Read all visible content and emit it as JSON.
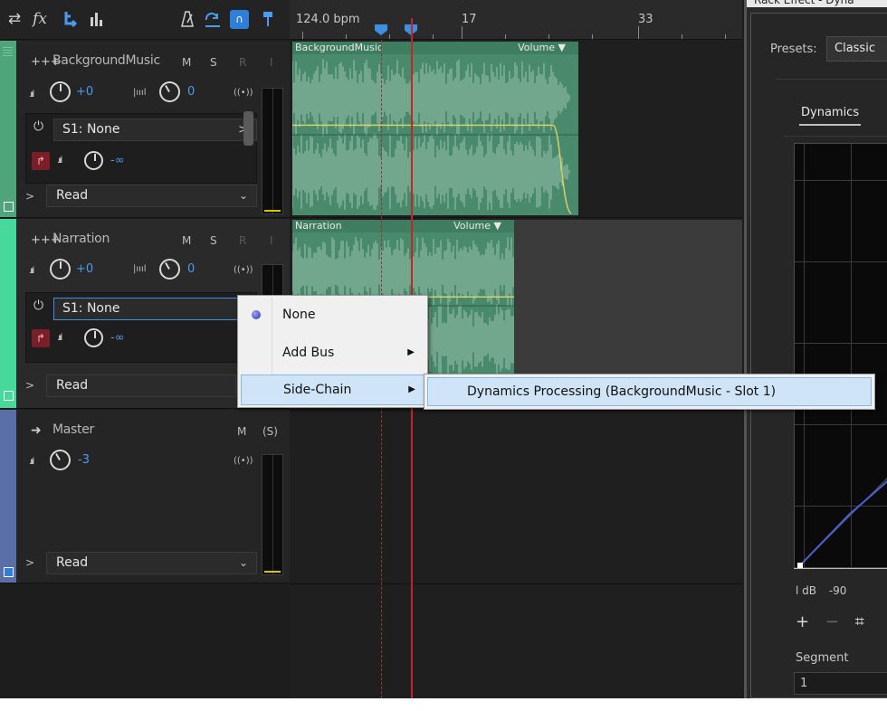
{
  "toolbar": {
    "icons": [
      "switch-arrows-icon",
      "fx-icon",
      "routing-icon",
      "meter-bars-icon",
      "metronome-icon",
      "loop-icon",
      "snap-magnet-icon",
      "marker-pin-icon"
    ],
    "fx_label": "fx"
  },
  "tracks": [
    {
      "name": "BackgroundMusic",
      "color": "#4fa57a",
      "mute": "M",
      "solo": "S",
      "record": "R",
      "input": "I",
      "volume": "+0",
      "pan": "0",
      "send": "S1: None",
      "send_volume": "-∞",
      "automation": "Read"
    },
    {
      "name": "Narration",
      "color": "#46d99b",
      "mute": "M",
      "solo": "S",
      "record": "R",
      "input": "I",
      "volume": "+0",
      "pan": "0",
      "send": "S1: None",
      "send_volume": "-∞",
      "automation": "Read"
    },
    {
      "name": "Master",
      "color": "#5a6fa8",
      "mute": "M",
      "solo": "(S)",
      "volume": "-3",
      "automation": "Read"
    }
  ],
  "timeline": {
    "bpm": "124.0 bpm",
    "bar_numbers": [
      "17",
      "33"
    ],
    "clips": [
      {
        "name": "BackgroundMusic",
        "envelope": "Volume ▼"
      },
      {
        "name": "Narration",
        "envelope": "Volume ▼"
      }
    ]
  },
  "context_menu": {
    "items": [
      {
        "label": "None",
        "selected": true
      },
      {
        "label": "Add Bus",
        "has_submenu": true
      },
      {
        "label": "Side-Chain",
        "has_submenu": true,
        "highlighted": true
      }
    ],
    "submenu": {
      "items": [
        {
          "label": "Dynamics Processing (BackgroundMusic - Slot 1)",
          "highlighted": true
        }
      ]
    }
  },
  "rack": {
    "title": "Rack Effect - Dyna",
    "presets_label": "Presets:",
    "preset_value": "Classic",
    "tab": "Dynamics",
    "db_labels": [
      "l dB",
      "-90"
    ],
    "controls": [
      "+",
      "−",
      "⌗"
    ],
    "segment_label": "Segment",
    "segment_value": "1"
  },
  "colors": {
    "accent": "#3d8fe0",
    "playhead": "#c0272d",
    "clip": "#4a8a6c",
    "menu_highlight": "#cfe4f7"
  }
}
